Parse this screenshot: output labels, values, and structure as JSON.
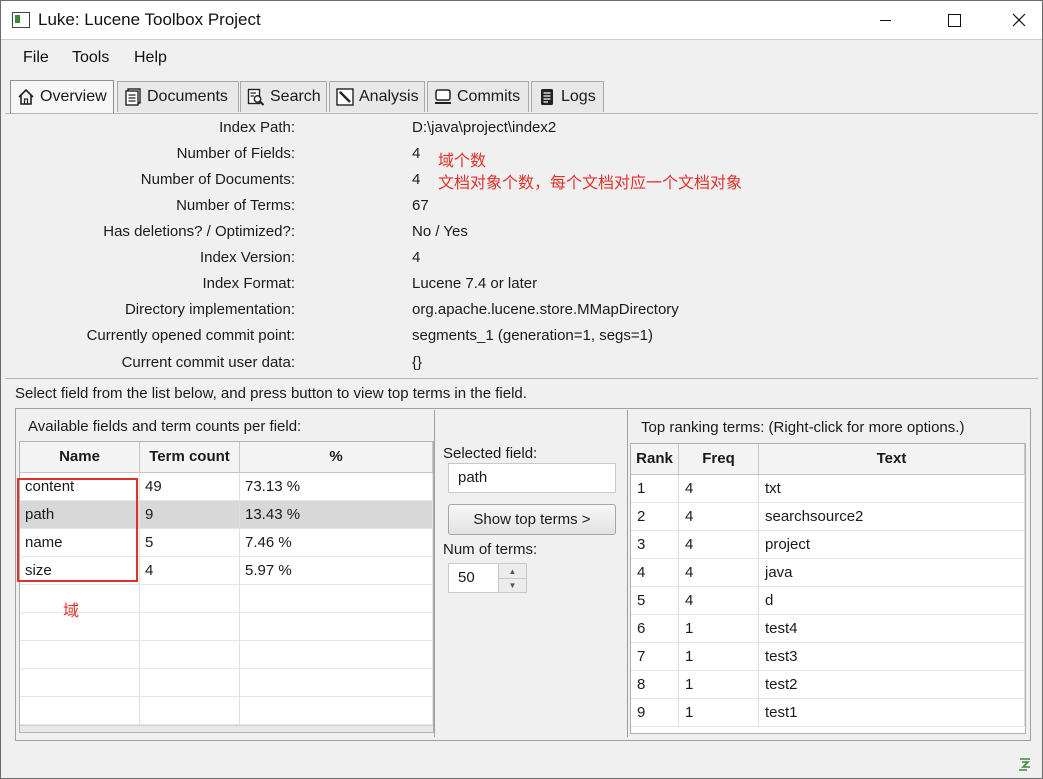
{
  "window": {
    "title": "Luke: Lucene Toolbox Project",
    "controls": [
      "minimize",
      "maximize",
      "close"
    ]
  },
  "menu": [
    "File",
    "Tools",
    "Help"
  ],
  "tabs": [
    {
      "label": "Overview",
      "icon": "home-icon",
      "active": true
    },
    {
      "label": "Documents",
      "icon": "documents-icon",
      "active": false
    },
    {
      "label": "Search",
      "icon": "search-icon",
      "active": false
    },
    {
      "label": "Analysis",
      "icon": "analysis-icon",
      "active": false
    },
    {
      "label": "Commits",
      "icon": "commits-icon",
      "active": false
    },
    {
      "label": "Logs",
      "icon": "logs-icon",
      "active": false
    }
  ],
  "overview": {
    "rows": [
      {
        "label": "Index Path:",
        "value": "D:\\java\\project\\index2"
      },
      {
        "label": "Number of Fields:",
        "value": "4"
      },
      {
        "label": "Number of Documents:",
        "value": "4"
      },
      {
        "label": "Number of Terms:",
        "value": "67"
      },
      {
        "label": "Has deletions? / Optimized?:",
        "value": "No / Yes"
      },
      {
        "label": "Index Version:",
        "value": "4"
      },
      {
        "label": "Index Format:",
        "value": "Lucene 7.4 or later"
      },
      {
        "label": "Directory implementation:",
        "value": "org.apache.lucene.store.MMapDirectory"
      },
      {
        "label": "Currently opened commit point:",
        "value": "segments_1 (generation=1, segs=1)"
      },
      {
        "label": "Current commit user data:",
        "value": "{}"
      }
    ],
    "annotations": {
      "fields": "域个数",
      "documents": "文档对象个数，每个文档对应一个文档对象",
      "field_box": "域"
    },
    "annotation_color": "#e0312a"
  },
  "instruction": "Select field from the list below, and press button to view top terms in the field.",
  "fields_panel": {
    "title": "Available fields and term counts per field:",
    "columns": [
      "Name",
      "Term count",
      "%"
    ],
    "rows": [
      {
        "name": "content",
        "count": "49",
        "pct": "73.13 %"
      },
      {
        "name": "path",
        "count": "9",
        "pct": "13.43 %",
        "selected": true
      },
      {
        "name": "name",
        "count": "5",
        "pct": "7.46 %"
      },
      {
        "name": "size",
        "count": "4",
        "pct": "5.97 %"
      }
    ]
  },
  "controls_panel": {
    "selected_field_label": "Selected field:",
    "selected_field_value": "path",
    "show_button": "Show top terms >",
    "num_terms_label": "Num of terms:",
    "num_terms_value": "50"
  },
  "terms_panel": {
    "title": "Top ranking terms: (Right-click for more options.)",
    "columns": [
      "Rank",
      "Freq",
      "Text"
    ],
    "rows": [
      {
        "rank": "1",
        "freq": "4",
        "text": "txt"
      },
      {
        "rank": "2",
        "freq": "4",
        "text": "searchsource2"
      },
      {
        "rank": "3",
        "freq": "4",
        "text": "project"
      },
      {
        "rank": "4",
        "freq": "4",
        "text": "java"
      },
      {
        "rank": "5",
        "freq": "4",
        "text": "d"
      },
      {
        "rank": "6",
        "freq": "1",
        "text": "test4"
      },
      {
        "rank": "7",
        "freq": "1",
        "text": "test3"
      },
      {
        "rank": "8",
        "freq": "1",
        "text": "test2"
      },
      {
        "rank": "9",
        "freq": "1",
        "text": "test1"
      }
    ]
  }
}
